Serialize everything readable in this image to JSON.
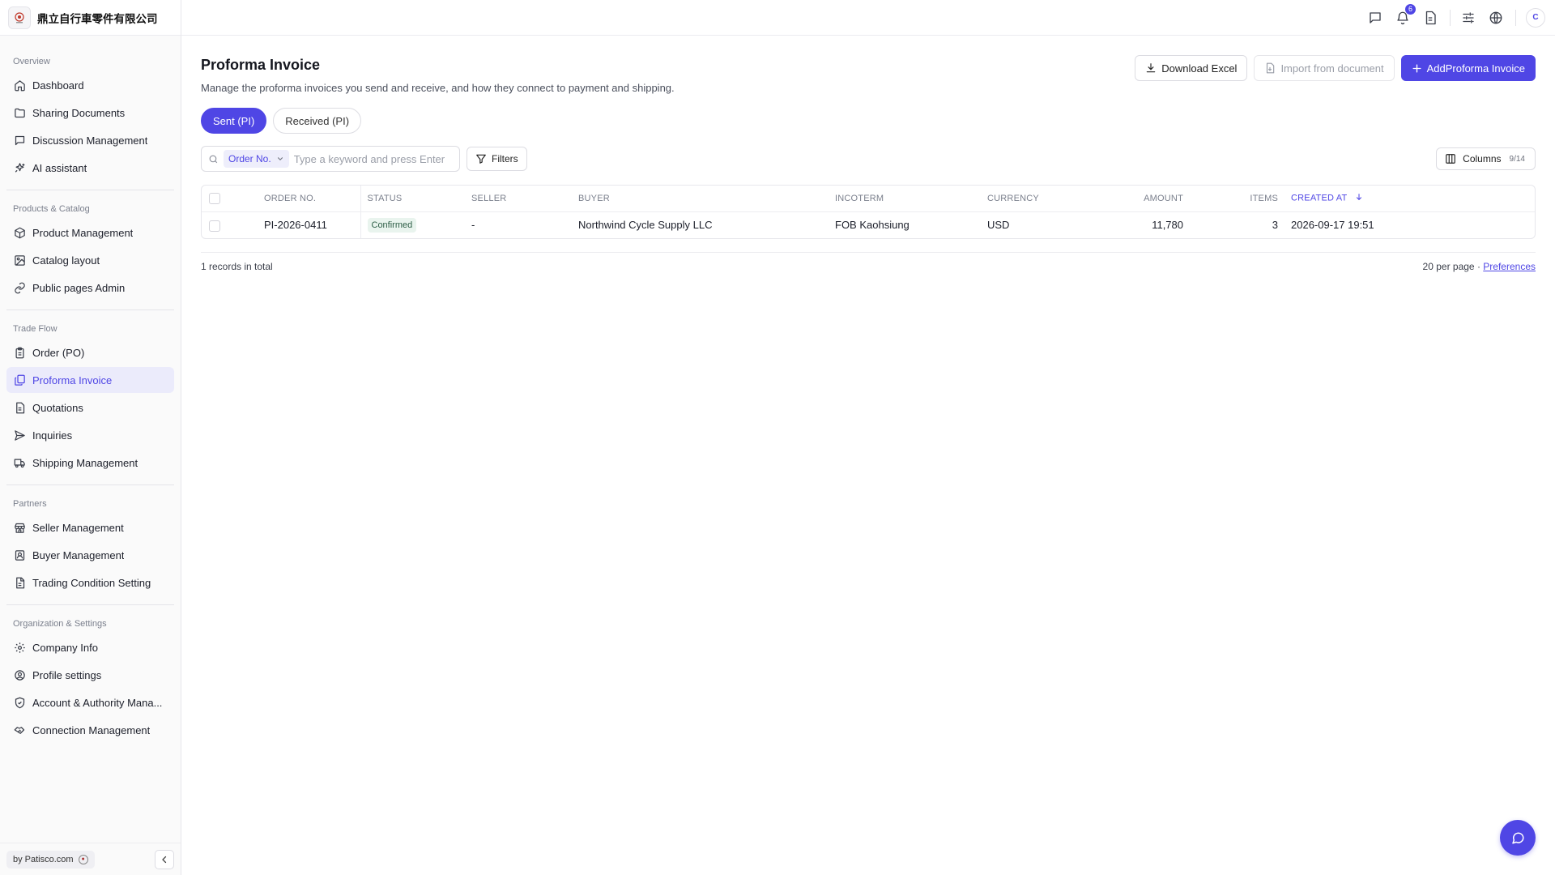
{
  "brand": {
    "name": "鼎立自行車零件有限公司",
    "logo_icon": "company-logo"
  },
  "sidebar": {
    "sections": [
      {
        "title": "Overview",
        "items": [
          {
            "label": "Dashboard",
            "icon": "home-icon"
          },
          {
            "label": "Sharing Documents",
            "icon": "folder-icon"
          },
          {
            "label": "Discussion Management",
            "icon": "message-icon"
          },
          {
            "label": "AI assistant",
            "icon": "sparkles-icon"
          }
        ]
      },
      {
        "title": "Products & Catalog",
        "items": [
          {
            "label": "Product Management",
            "icon": "package-icon"
          },
          {
            "label": "Catalog layout",
            "icon": "image-icon"
          },
          {
            "label": "Public pages Admin",
            "icon": "link-icon"
          }
        ]
      },
      {
        "title": "Trade Flow",
        "items": [
          {
            "label": "Order (PO)",
            "icon": "clipboard-icon"
          },
          {
            "label": "Proforma Invoice",
            "icon": "invoice-icon",
            "active": true
          },
          {
            "label": "Quotations",
            "icon": "document-icon"
          },
          {
            "label": "Inquiries",
            "icon": "send-icon"
          },
          {
            "label": "Shipping Management",
            "icon": "truck-icon"
          }
        ]
      },
      {
        "title": "Partners",
        "items": [
          {
            "label": "Seller Management",
            "icon": "store-icon"
          },
          {
            "label": "Buyer Management",
            "icon": "contact-icon"
          },
          {
            "label": "Trading Condition Setting",
            "icon": "file-text-icon"
          }
        ]
      },
      {
        "title": "Organization & Settings",
        "items": [
          {
            "label": "Company Info",
            "icon": "gear-icon"
          },
          {
            "label": "Profile settings",
            "icon": "user-circle-icon"
          },
          {
            "label": "Account & Authority Mana...",
            "icon": "shield-icon"
          },
          {
            "label": "Connection Management",
            "icon": "handshake-icon"
          }
        ]
      }
    ],
    "footer": {
      "powered_by": "by Patisco.com"
    }
  },
  "topbar": {
    "notification_count": "6",
    "avatar_initial": "C"
  },
  "page": {
    "title": "Proforma Invoice",
    "description": "Manage the proforma invoices you send and receive, and how they connect to payment and shipping.",
    "actions": {
      "download": "Download Excel",
      "import": "Import from document",
      "add": "AddProforma Invoice"
    },
    "tabs": [
      {
        "label": "Sent (PI)",
        "active": true
      },
      {
        "label": "Received (PI)",
        "active": false
      }
    ],
    "search": {
      "field": "Order No.",
      "placeholder": "Type a keyword and press Enter"
    },
    "filters_label": "Filters",
    "columns": {
      "label": "Columns",
      "count": "9/14"
    }
  },
  "table": {
    "headers": {
      "order_no": "ORDER NO.",
      "status": "STATUS",
      "seller": "SELLER",
      "buyer": "BUYER",
      "incoterm": "INCOTERM",
      "currency": "CURRENCY",
      "amount": "AMOUNT",
      "items": "ITEMS",
      "created_at": "CREATED AT"
    },
    "rows": [
      {
        "order_no": "PI-2026-0411",
        "status": "Confirmed",
        "seller": "-",
        "buyer": "Northwind Cycle Supply LLC",
        "incoterm": "FOB Kaohsiung",
        "currency": "USD",
        "amount": "11,780",
        "items": "3",
        "created_at": "2026-09-17 19:51"
      }
    ],
    "summary": "1 records in total",
    "per_page": "20 per page",
    "separator": "·",
    "preferences": "Preferences"
  },
  "colors": {
    "accent": "#4f46e5",
    "status_confirmed_bg": "#e9f4ee"
  }
}
